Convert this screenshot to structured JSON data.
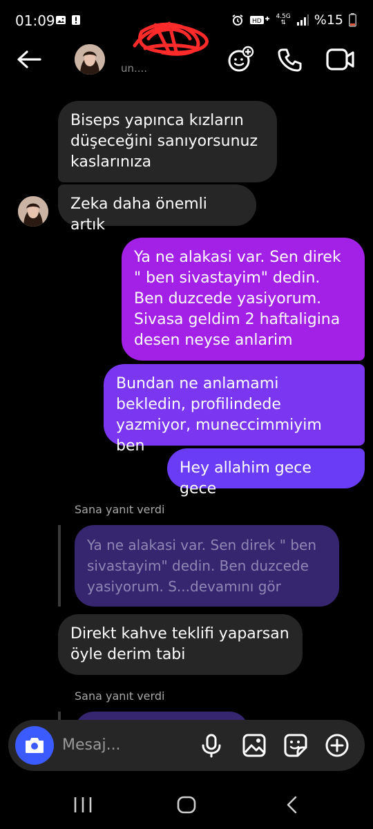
{
  "status_bar": {
    "time": "01:09",
    "battery": "%15",
    "network": "4.5G"
  },
  "header": {
    "subtitle": "un...."
  },
  "messages": [
    {
      "side": "in",
      "text": "Biseps yapınca kızların düşeceğini sanıyorsunuz kaslarınıza"
    },
    {
      "side": "in",
      "text": "Zeka daha önemli artık"
    },
    {
      "side": "out",
      "text": "Ya ne alakasi var. Sen direk \" ben sivastayim\" dedin. Ben duzcede yasiyorum. Sivasa geldim 2 haftaligina desen neyse anlarim"
    },
    {
      "side": "out",
      "text": "Bundan ne anlamami bekledin, profilindede yazmiyor, muneccimmiyim ben"
    },
    {
      "side": "out",
      "text": "Hey allahim gece gece"
    },
    {
      "side": "in",
      "text": "Direkt kahve teklifi yaparsan öyle derim tabi"
    }
  ],
  "replies": [
    {
      "label": "Sana yanıt verdi",
      "quote": "Ya ne alakasi var. Sen direk \" ben sivastayim\" dedin. Ben duzcede yasiyorum. S...devamını gör"
    },
    {
      "label": "Sana yanıt verdi"
    }
  ],
  "composer": {
    "placeholder": "Mesaj..."
  },
  "colors": {
    "background": "#000000",
    "incoming_bubble": "#262626",
    "outgoing_top": "#a020e8",
    "outgoing_bottom": "#6a3cf6",
    "camera_button": "#3b5bff",
    "quote_bubble": "#36266f",
    "name_scribble": "#ff2a2a"
  },
  "icons": [
    "back-arrow-icon",
    "effects-icon",
    "phone-icon",
    "video-icon",
    "camera-icon",
    "microphone-icon",
    "gallery-icon",
    "sticker-icon",
    "plus-icon",
    "recent-apps-icon",
    "home-icon",
    "back-nav-icon"
  ]
}
